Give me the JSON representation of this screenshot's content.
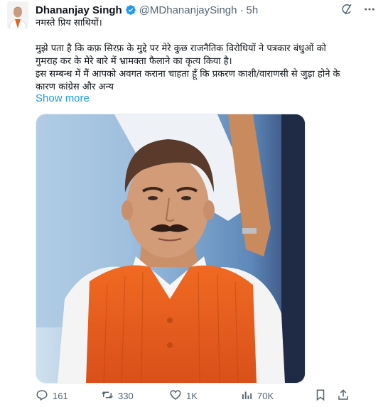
{
  "tweet": {
    "author_name": "Dhananjay Singh",
    "handle": "@MDhananjaySingh",
    "separator": "·",
    "time": "5h",
    "text_lines": [
      "नमस्ते प्रिय साथियों।",
      "",
      "मुझे पता है कि कफ़ सिरफ़ के मुद्दे पर मेरे कुछ राजनैतिक विरोधियों ने पत्रकार बंधुओं को",
      "गुमराह कर के मेरे बारे में भ्रामक्ता फैलाने का कृत्य किया है।",
      "इस सम्बन्ध में मैं आपको अवगत कराना चाहता हूँ कि प्रकरण काशी/वाराणसी से जुड़ा होने के",
      "कारण कांग्रेस और अन्य"
    ],
    "show_more": "Show more",
    "stats": {
      "replies": "161",
      "reposts": "330",
      "likes": "1K",
      "views": "70K"
    }
  },
  "icons": {
    "verified": "verified-badge-icon",
    "grok": "grok-icon",
    "more": "more-horizontal-icon",
    "reply": "reply-icon",
    "repost": "repost-icon",
    "like": "heart-icon",
    "views": "views-chart-icon",
    "bookmark": "bookmark-icon",
    "share": "share-icon"
  },
  "colors": {
    "accent": "#1d9bf0",
    "secondary_text": "#536471",
    "vest": "#e8621e"
  }
}
